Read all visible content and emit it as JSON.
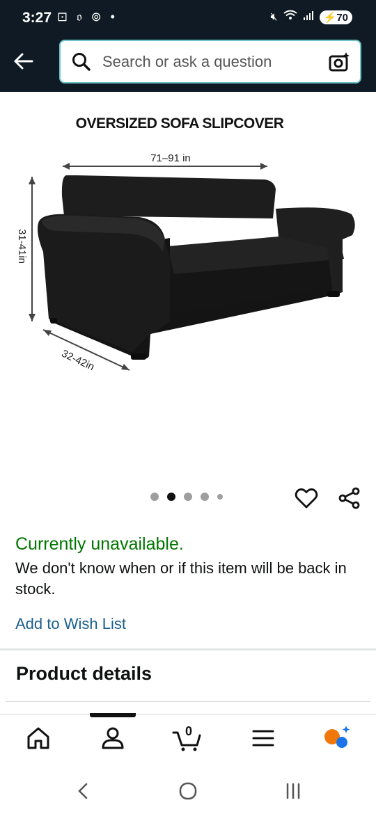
{
  "status_bar": {
    "time": "3:27",
    "left_icons": "⊡ 𝔬 ⊚ •",
    "battery": "70"
  },
  "search": {
    "placeholder": "Search or ask a question"
  },
  "product": {
    "image_title": "OVERSIZED SOFA SLIPCOVER",
    "width_dim": "71–91 in",
    "height_dim": "31-41in",
    "depth_dim": "32-42in"
  },
  "carousel": {
    "count": 5,
    "active_index": 1
  },
  "availability": {
    "status": "Currently unavailable.",
    "note": "We don't know when or if this item will be back in stock.",
    "wishlist_label": "Add to Wish List"
  },
  "details": {
    "title": "Product details"
  },
  "bottom_nav": {
    "cart_count": "0"
  },
  "colors": {
    "header_bg": "#0f1a24",
    "available_green": "#007600",
    "link_blue": "#1a5e8c",
    "search_border": "#6cc4c9"
  }
}
